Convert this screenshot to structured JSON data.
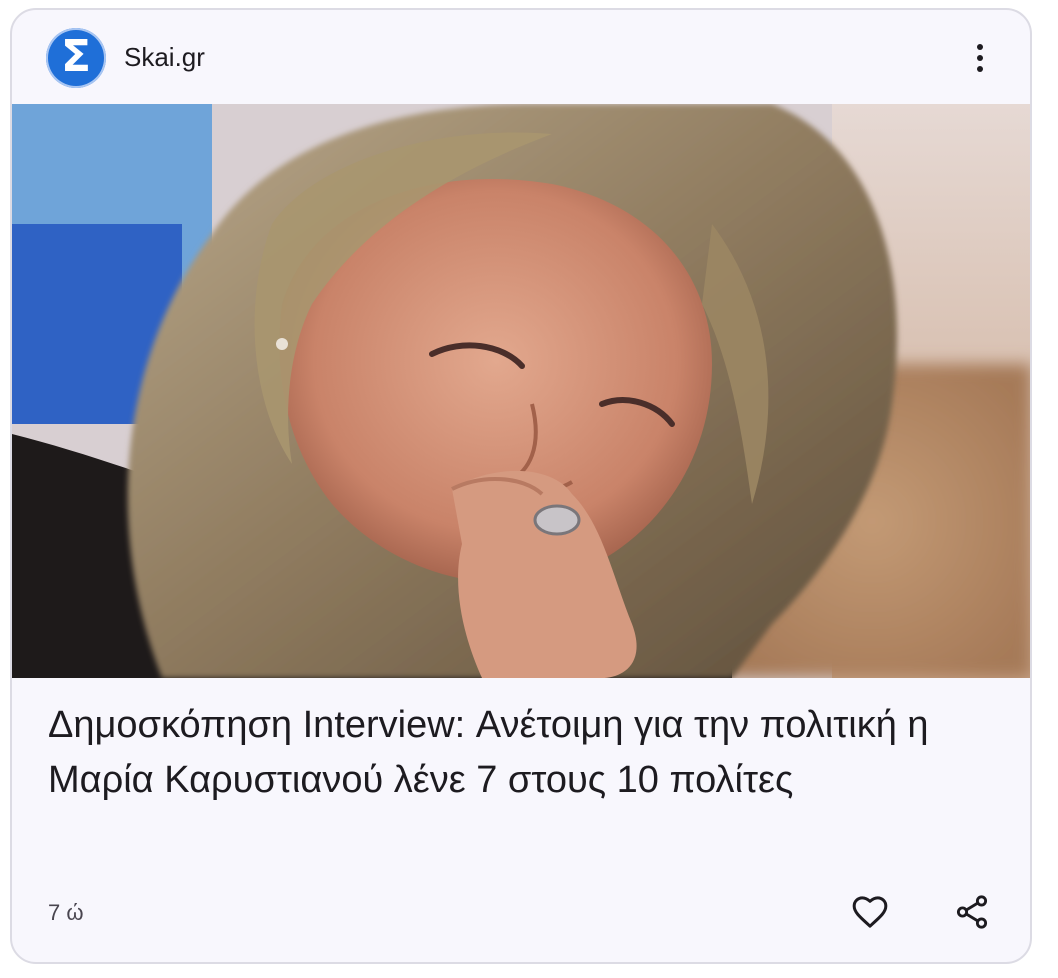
{
  "source": {
    "name": "Skai.gr",
    "logo_glyph": "Σ",
    "logo_color": "#1f6fd8"
  },
  "menu": {
    "icon": "more-vert-icon"
  },
  "article": {
    "headline": "Δημοσκόπηση Interview: Ανέτοιμη για την πολιτική η Μαρία Καρυστιανού λένε 7 στους 10 πολίτες",
    "age": "7 ώ"
  },
  "actions": {
    "like_icon": "heart-outline-icon",
    "share_icon": "share-icon"
  }
}
